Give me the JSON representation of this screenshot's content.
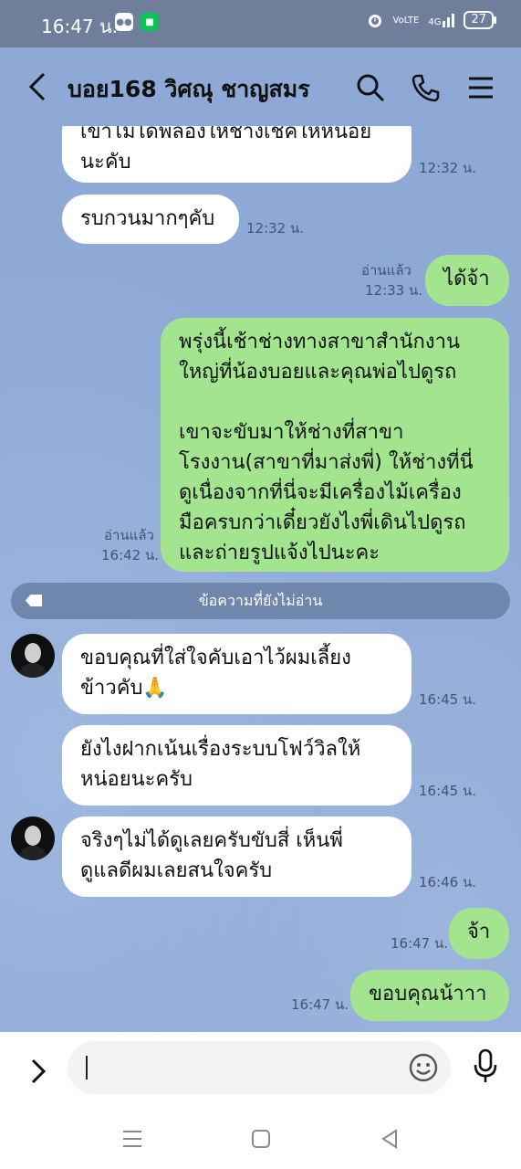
{
  "status_bar": {
    "time": "16:47 น.",
    "network": "VoLTE",
    "signal": "4G",
    "battery": "27"
  },
  "header": {
    "title": "บอย168 วิศณุ ชาญสมร",
    "icons": [
      "back-chevron-icon",
      "search-icon",
      "phone-icon",
      "menu-icon"
    ]
  },
  "messages": [
    {
      "side": "in",
      "text_line1": "เขาไม่ได้พี่ลองให้ช่างเช็คให้หน่อย",
      "text_line2": "นะคับ",
      "time": "12:32 น."
    },
    {
      "side": "in",
      "text": "รบกวนมากๆคับ",
      "time": "12:32 น."
    },
    {
      "side": "out",
      "text": "ได้จ้า",
      "read": "อ่านแล้ว",
      "time": "12:33 น."
    },
    {
      "side": "out",
      "lines": [
        "พรุ่งนี้เช้าช่างทางสาขาสำนักงาน",
        "ใหญ่ที่น้องบอยและคุณพ่อไปดูรถ",
        "",
        "เขาจะขับมาให้ช่างที่สาขา",
        "โรงงาน(สาขาที่มาส่งพี่) ให้ช่างที่นี่",
        "ดูเนื่องจากที่นี่จะมีเครื่องไม้เครื่อง",
        "มือครบกว่าเดี๋ยวยังไงพี่เดินไปดูรถ",
        "และถ่ายรูปแจ้งไปนะคะ"
      ],
      "read": "อ่านแล้ว",
      "time": "16:42 น."
    },
    {
      "side": "in",
      "lines": [
        "ขอบคุณที่ใส่ใจคับเอาไว้ผมเลี้ยง",
        "ข้าวคับ🙏"
      ],
      "time": "16:45 น."
    },
    {
      "side": "in",
      "lines": [
        "ยังไงฝากเน้นเรื่องระบบโฟว์วิลให้",
        "หน่อยนะครับ"
      ],
      "time": "16:45 น."
    },
    {
      "side": "in",
      "lines": [
        "จริงๆไม่ได้ดูเลยครับขับสี่ เห็นพี่",
        "ดูแลดีผมเลยสนใจครับ"
      ],
      "time": "16:46 น."
    },
    {
      "side": "out",
      "text": "จ้า",
      "time": "16:47 น."
    },
    {
      "side": "out",
      "text": "ขอบคุณน้าาา",
      "time": "16:47 น."
    }
  ],
  "unread_divider": "ข้อความที่ยังไม่อ่าน",
  "input": {
    "placeholder": "",
    "value": ""
  },
  "colors": {
    "chat_bg": "#8ea9d6",
    "outgoing_bubble": "#a3e48e",
    "incoming_bubble": "#ffffff",
    "status_bar": "#6f7f9b"
  }
}
